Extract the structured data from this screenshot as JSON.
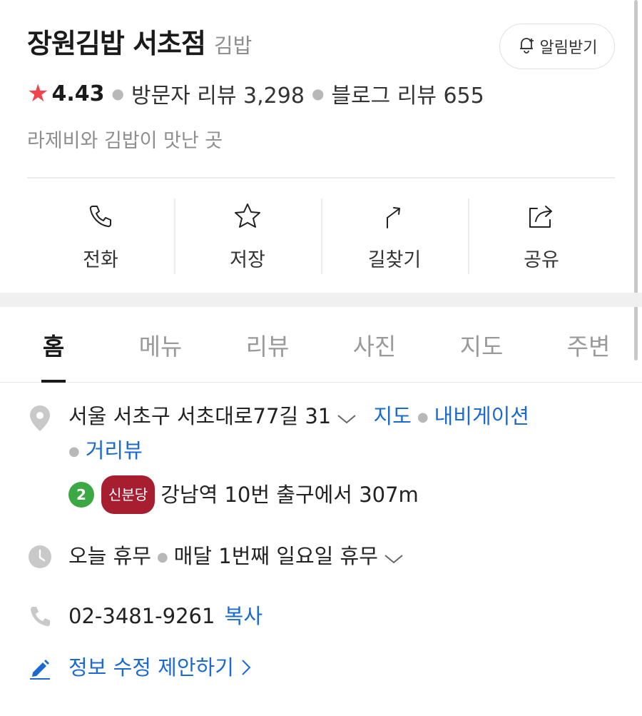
{
  "place": {
    "name": "장원김밥 서초점",
    "category": "김밥",
    "notify_label": "알림받기",
    "rating": "4.43",
    "visitor_review": "방문자 리뷰 3,298",
    "blog_review": "블로그 리뷰 655",
    "description": "라제비와 김밥이 맛난 곳"
  },
  "actions": [
    {
      "label": "전화",
      "icon": "phone-icon"
    },
    {
      "label": "저장",
      "icon": "star-outline-icon"
    },
    {
      "label": "길찾기",
      "icon": "directions-icon"
    },
    {
      "label": "공유",
      "icon": "share-icon"
    }
  ],
  "tabs": [
    {
      "label": "홈",
      "active": true
    },
    {
      "label": "메뉴"
    },
    {
      "label": "리뷰"
    },
    {
      "label": "사진"
    },
    {
      "label": "지도"
    },
    {
      "label": "주변"
    }
  ],
  "info": {
    "address": "서울 서초구 서초대로77길 31",
    "map_link": "지도",
    "navi_link": "내비게이션",
    "street_view_link": "거리뷰",
    "subway_line": "2",
    "subway_line_badge": "신분당",
    "subway_text": "강남역 10번 출구에서 307m",
    "hours_status": "오늘 휴무",
    "hours_detail": "매달 1번째 일요일 휴무",
    "phone": "02-3481-9261",
    "copy_label": "복사",
    "suggest_edit": "정보 수정 제안하기"
  },
  "colors": {
    "accent_link": "#1b6ad0",
    "star": "#f0454c",
    "line2": "#3ca844",
    "shinbundang": "#a71e31"
  }
}
